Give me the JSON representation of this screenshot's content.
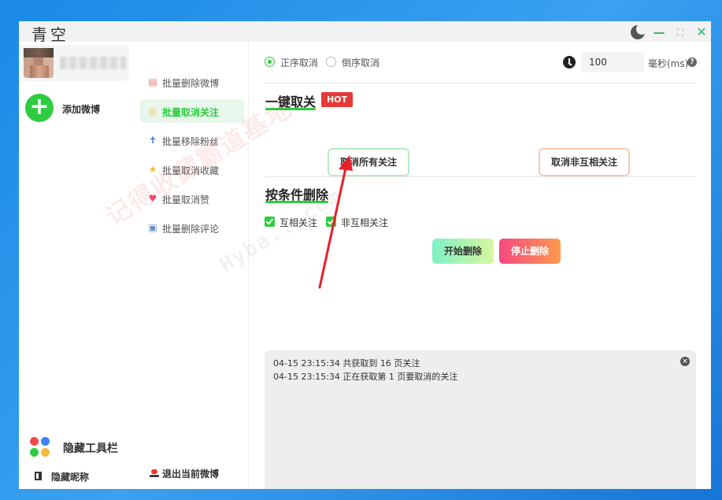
{
  "window": {
    "title": "青空"
  },
  "account_sidebar": {
    "add_weibo_label": "添加微博",
    "hide_toolbar_label": "隐藏工具栏",
    "hide_nickname_label": "隐藏昵称",
    "toolbar_dot_colors": [
      "#f14c4c",
      "#3b82f6",
      "#2ecc40",
      "#f6b93b"
    ]
  },
  "nav": {
    "items": [
      {
        "label": "批量删除微博",
        "icon": "document-icon",
        "active": false
      },
      {
        "label": "批量取消关注",
        "icon": "user-circle-icon",
        "active": true
      },
      {
        "label": "批量移除粉丝",
        "icon": "person-icon",
        "active": false
      },
      {
        "label": "批量取消收藏",
        "icon": "star-icon",
        "active": false
      },
      {
        "label": "批量取消赞",
        "icon": "heart-icon",
        "active": false
      },
      {
        "label": "批量删除评论",
        "icon": "comment-icon",
        "active": false
      }
    ],
    "logout_label": "退出当前微博"
  },
  "main": {
    "order_options": [
      {
        "label": "正序取消",
        "selected": true
      },
      {
        "label": "倒序取消",
        "selected": false
      }
    ],
    "delay_value": "100",
    "delay_unit": "毫秒(ms)",
    "help_glyph": "?",
    "one_click": {
      "title": "一键取关",
      "badge": "HOT",
      "cancel_all_label": "取消所有关注",
      "cancel_non_mutual_label": "取消非互相关注"
    },
    "conditional": {
      "title": "按条件删除",
      "checkboxes": [
        {
          "label": "互相关注",
          "checked": true
        },
        {
          "label": "非互相关注",
          "checked": true
        }
      ],
      "start_label": "开始删除",
      "stop_label": "停止删除"
    },
    "log": {
      "lines": [
        "04-15 23:15:34 共获取到 16 页关注",
        "04-15 23:15:34 正在获取第 1 页要取消的关注"
      ],
      "close_glyph": "×"
    }
  },
  "watermark": {
    "text": "记得收藏霸道基地",
    "text2": "Hyba...com"
  }
}
